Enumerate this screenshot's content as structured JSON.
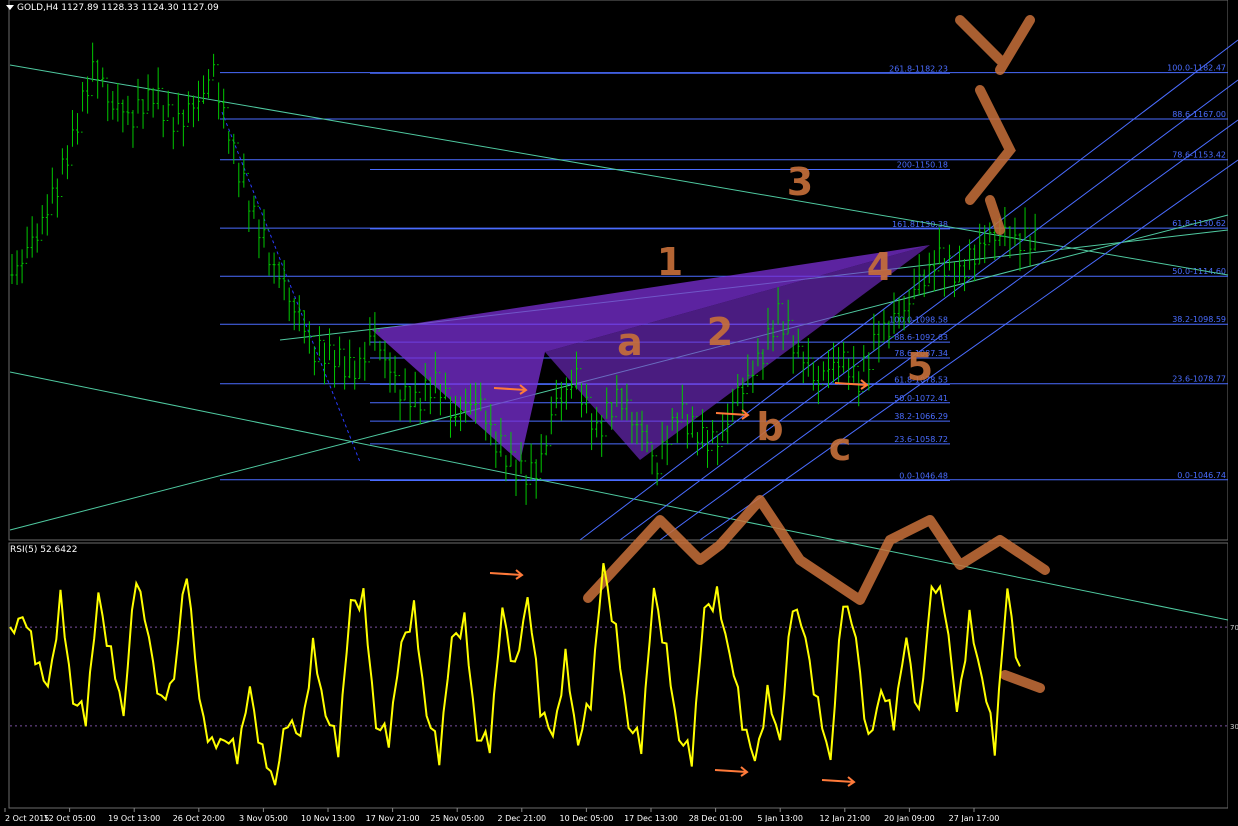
{
  "header": {
    "symbol_info": "GOLD,H4  1127.89 1128.33 1124.30 1127.09"
  },
  "rsi_panel": {
    "title": "RSI(5) 52.6422",
    "levels": [
      70,
      30
    ],
    "color": "#ffff00"
  },
  "colors": {
    "candle": "#00c800",
    "fib": "#4a6cff",
    "trend": "#4fc9a0",
    "pattern": "#7b2fd6",
    "annotation": "#c8703a",
    "arrow": "#ff7a3a"
  },
  "chart_data": [
    {
      "type": "line",
      "title": "GOLD,H4",
      "price_y_range": [
        1030,
        1200
      ],
      "x_ticks": [
        "2 Oct 2015",
        "12 Oct 05:00",
        "19 Oct 13:00",
        "26 Oct 20:00",
        "3 Nov 05:00",
        "10 Nov 13:00",
        "17 Nov 21:00",
        "25 Nov 05:00",
        "2 Dec 21:00",
        "10 Dec 05:00",
        "17 Dec 13:00",
        "28 Dec 01:00",
        "5 Jan 13:00",
        "12 Jan 21:00",
        "20 Jan 09:00",
        "27 Jan 17:00"
      ],
      "close_series": [
        1115,
        1125,
        1140,
        1160,
        1185,
        1172,
        1168,
        1176,
        1165,
        1170,
        1182,
        1155,
        1135,
        1118,
        1105,
        1090,
        1088,
        1082,
        1095,
        1078,
        1072,
        1080,
        1068,
        1075,
        1060,
        1050,
        1048,
        1072,
        1080,
        1062,
        1075,
        1066,
        1052,
        1070,
        1062,
        1058,
        1075,
        1085,
        1102,
        1090,
        1080,
        1088,
        1080,
        1095,
        1100,
        1112,
        1120,
        1115,
        1125,
        1130,
        1127
      ],
      "fib_levels_left": [
        "261.8-1182.23",
        "200-1150.18",
        "161.81130.38",
        "100.0-1098.58",
        "88.6-1092.63",
        "78.6-1087.34",
        "61.8-1078.53",
        "50.0-1072.41",
        "38.2-1066.29",
        "23.6-1058.72",
        "0.0-1046.48"
      ],
      "fib_levels_right": [
        "100.0-1182.47",
        "88.6-1167.00",
        "78.6-1153.42",
        "61.8-1130.62",
        "50.0-1114.60",
        "38.2-1098.59",
        "23.6-1078.77",
        "0.0-1046.74"
      ],
      "annotations": [
        "1",
        "2",
        "3",
        "4",
        "5",
        "a",
        "b",
        "c"
      ]
    },
    {
      "type": "line",
      "title": "RSI(5) 52.6422",
      "y_range": [
        0,
        100
      ],
      "levels": [
        70,
        30
      ],
      "values": [
        70,
        80,
        55,
        40,
        85,
        45,
        30,
        78,
        62,
        40,
        88,
        60,
        42,
        55,
        90,
        35,
        25,
        30,
        15,
        40,
        22,
        12,
        30,
        20,
        65,
        40,
        18,
        75,
        85,
        35,
        22,
        58,
        80,
        40,
        15,
        60,
        75,
        30,
        20,
        72,
        55,
        88,
        35,
        20,
        60,
        28,
        38,
        90,
        70,
        35,
        20,
        80,
        62,
        30,
        15,
        72,
        85,
        65,
        30,
        10,
        45,
        30,
        78,
        60,
        40,
        22,
        80,
        60,
        25,
        50,
        30,
        60,
        35,
        92,
        78,
        30,
        75,
        55,
        20,
        80,
        52
      ]
    }
  ]
}
